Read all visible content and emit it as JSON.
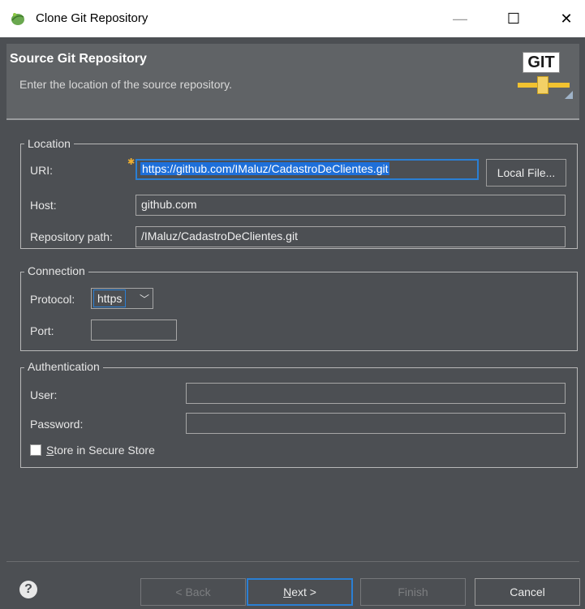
{
  "window": {
    "title": "Clone Git Repository",
    "minimize_glyph": "—",
    "maximize_glyph": "☐",
    "close_glyph": "✕"
  },
  "header": {
    "title": "Source Git Repository",
    "description": "Enter the location of the source repository.",
    "logo_text": "GIT"
  },
  "location": {
    "legend": "Location",
    "uri_label": "URI:",
    "uri_value": "https://github.com/IMaluz/CadastroDeClientes.git",
    "local_file_button": "Local File...",
    "host_label": "Host:",
    "host_value": "github.com",
    "repo_path_label": "Repository path:",
    "repo_path_value": "/IMaluz/CadastroDeClientes.git"
  },
  "connection": {
    "legend": "Connection",
    "protocol_label": "Protocol:",
    "protocol_value": "https",
    "port_label": "Port:",
    "port_value": ""
  },
  "authentication": {
    "legend": "Authentication",
    "user_label": "User:",
    "user_value": "",
    "password_label": "Password:",
    "password_value": "",
    "store_label_first": "S",
    "store_label_rest": "tore in Secure Store",
    "store_checked": false
  },
  "footer": {
    "help_glyph": "?",
    "back_label": "< Back",
    "next_first": "N",
    "next_rest": "ext >",
    "finish_label": "Finish",
    "cancel_label": "Cancel"
  },
  "colors": {
    "background": "#4c4f53",
    "header_band": "#606366",
    "accent": "#2a7fd4",
    "selection": "#1e6fd9"
  }
}
